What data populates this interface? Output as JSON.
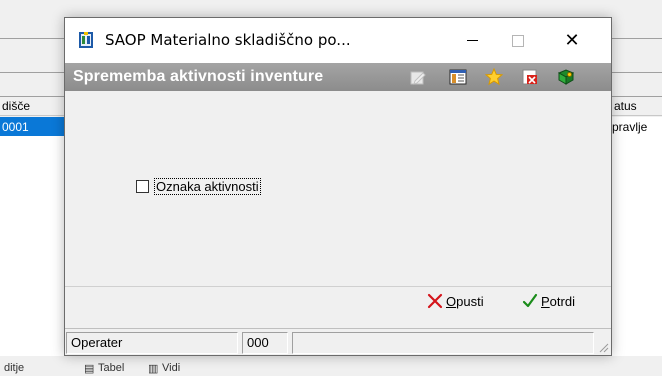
{
  "background": {
    "grid_columns": [
      "dišče",
      "atus"
    ],
    "selected_row": {
      "first_cell": "0001",
      "status_cell": "pravlje"
    },
    "bottom_items": [
      "ditje",
      "Tabel",
      "Vidi"
    ]
  },
  "dialog": {
    "window_title": "SAOP Materialno skladiščno po...",
    "header_title": "Sprememba aktivnosti inventure",
    "toolbar_icons": [
      "edit-icon",
      "columns-icon",
      "favorite-star-icon",
      "close-document-icon",
      "help-book-icon"
    ],
    "checkbox": {
      "label": "Oznaka aktivnosti",
      "checked": false
    },
    "buttons": {
      "cancel_prefix": "",
      "cancel_underlined": "O",
      "cancel_rest": "pusti",
      "confirm_prefix": "",
      "confirm_underlined": "P",
      "confirm_rest": "otrdi"
    },
    "status": {
      "operator_label": "Operater",
      "operator_value": "000",
      "extra_value": ""
    },
    "colors": {
      "header_strip": "#9a9a9a",
      "selection": "#0a78d7",
      "cancel_icon": "#d4141b",
      "confirm_icon": "#1a8c1a"
    }
  }
}
